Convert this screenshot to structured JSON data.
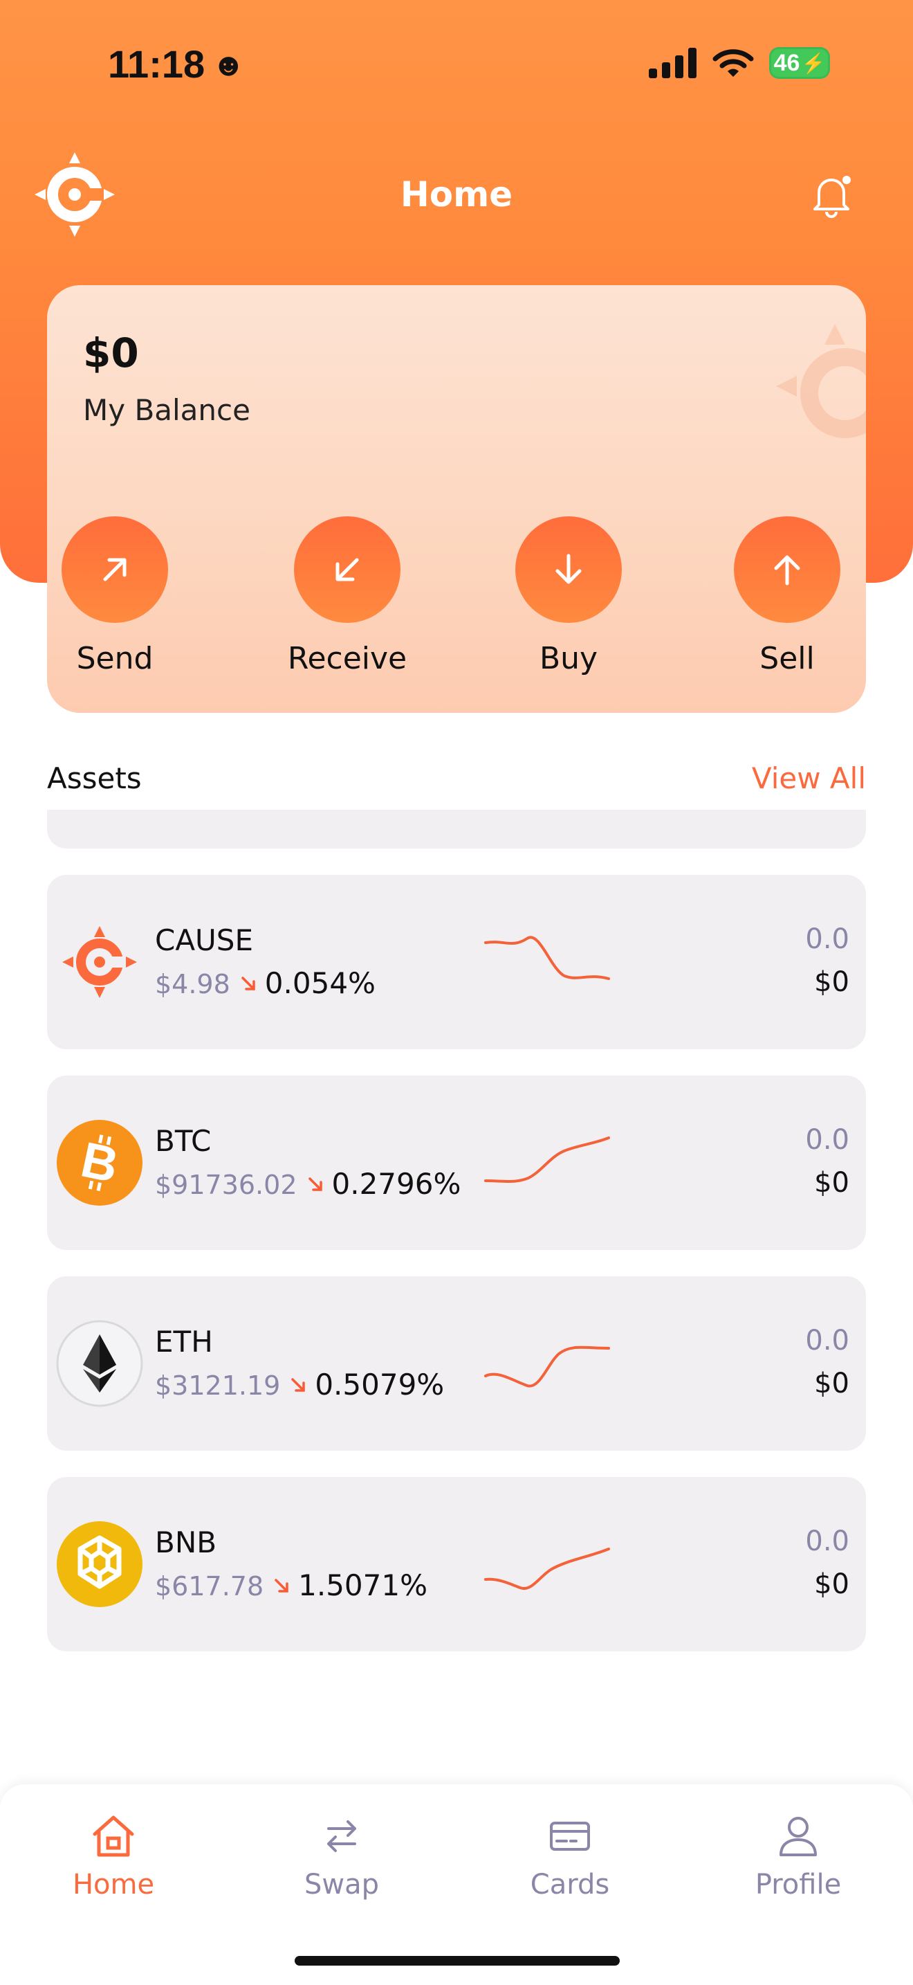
{
  "status_bar": {
    "time": "11:18",
    "emoji": "☻",
    "battery": "46"
  },
  "header": {
    "title": "Home"
  },
  "balance_card": {
    "amount": "$0",
    "label": "My Balance",
    "actions": [
      {
        "label": "Send",
        "icon": "arrow-up-right-icon"
      },
      {
        "label": "Receive",
        "icon": "arrow-down-left-icon"
      },
      {
        "label": "Buy",
        "icon": "arrow-down-icon"
      },
      {
        "label": "Sell",
        "icon": "arrow-up-icon"
      }
    ]
  },
  "assets": {
    "title": "Assets",
    "view_all": "View All",
    "items": [
      {
        "symbol": "CAUSE",
        "price": "$4.98",
        "change": "0.054%",
        "quantity": "0.0",
        "value": "$0",
        "trend": "down"
      },
      {
        "symbol": "BTC",
        "price": "$91736.02",
        "change": "0.2796%",
        "quantity": "0.0",
        "value": "$0",
        "trend": "down"
      },
      {
        "symbol": "ETH",
        "price": "$3121.19",
        "change": "0.5079%",
        "quantity": "0.0",
        "value": "$0",
        "trend": "down"
      },
      {
        "symbol": "BNB",
        "price": "$617.78",
        "change": "1.5071%",
        "quantity": "0.0",
        "value": "$0",
        "trend": "down"
      }
    ]
  },
  "bottom_nav": {
    "items": [
      {
        "label": "Home",
        "icon": "home-icon",
        "active": true
      },
      {
        "label": "Swap",
        "icon": "swap-icon",
        "active": false
      },
      {
        "label": "Cards",
        "icon": "card-icon",
        "active": false
      },
      {
        "label": "Profile",
        "icon": "profile-icon",
        "active": false
      }
    ]
  },
  "colors": {
    "accent": "#fb6a3c",
    "header_top": "#ff9446",
    "muted_text": "#8a86a8",
    "card_bg": "#f1eff1",
    "btc": "#f7931a",
    "bnb": "#f0b90b"
  }
}
